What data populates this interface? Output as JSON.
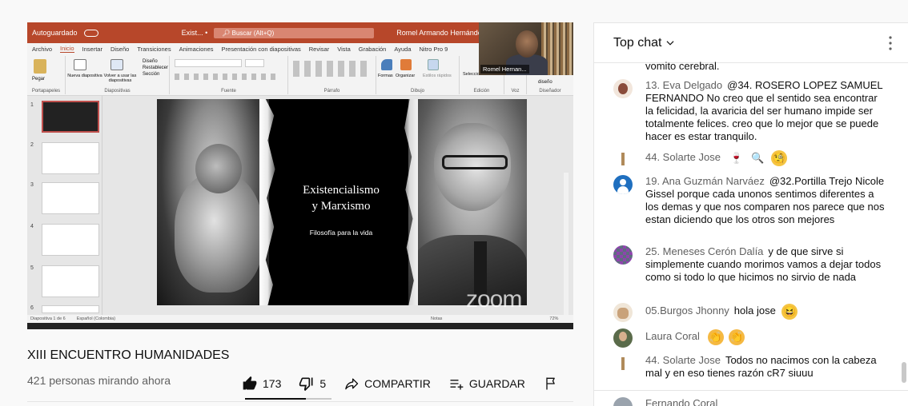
{
  "ppt": {
    "titlebar": {
      "autosave": "Autoguardado",
      "file": "Exist... •",
      "search": "Buscar (Alt+Q)",
      "user": "Romel Armando Hernández Sil..."
    },
    "tabs": [
      "Archivo",
      "Inicio",
      "Insertar",
      "Diseño",
      "Transiciones",
      "Animaciones",
      "Presentación con diapositivas",
      "Revisar",
      "Vista",
      "Grabación",
      "Ayuda",
      "Nitro Pro 9"
    ],
    "active_tab": "Inicio",
    "ribbon_groups": [
      "Portapapeles",
      "Diapositivas",
      "Fuente",
      "Párrafo",
      "Dibujo",
      "Edición",
      "Voz",
      "Diseñador"
    ],
    "ribbon_labels": {
      "paste": "Pegar",
      "new_slide": "Nueva diapositiva",
      "reuse": "Volver a usar las diapositivas",
      "layout": "Diseño",
      "reset": "Restablecer",
      "section": "Sección",
      "shapes": "Formas",
      "arrange": "Organizar",
      "styles": "Estilos rápidos",
      "select": "Seleccionar",
      "ideas": "diseño"
    },
    "slide_numbers": [
      "1",
      "2",
      "3",
      "4",
      "5",
      "6"
    ],
    "slide": {
      "title_line1": "Existencialismo",
      "title_line2": "y Marxismo",
      "subtitle": "Filosofía para la vida"
    },
    "webcam_name": "Romel Hernan...",
    "status_left": "Diapositiva 1 de 6",
    "status_lang": "Español (Colombia)",
    "status_notes": "Notas",
    "zoom_pct": "72%",
    "watermark": "zoom"
  },
  "video": {
    "title": "XIII ENCUENTRO HUMANIDADES",
    "viewers": "421 personas mirando ahora",
    "likes": "173",
    "dislikes": "5",
    "share_label": "COMPARTIR",
    "save_label": "GUARDAR",
    "like_ratio": 0.7
  },
  "chat": {
    "header": "Top chat",
    "messages": [
      {
        "author": "",
        "text": "vomito cerebral."
      },
      {
        "author": "13. Eva Delgado",
        "text": "@34. ROSERO LOPEZ SAMUEL FERNANDO No creo que el sentido sea encontrar la felicidad, la avaricia del ser humano impide ser totalmente felices. creo que lo mejor que se puede hacer es estar tranquilo."
      },
      {
        "author": "44. Solarte Jose",
        "text": "",
        "emojis": [
          "wine-glass-emoji",
          "magnifier-emoji",
          "monocle-face-emoji"
        ]
      },
      {
        "author": "19. Ana Guzmán Narváez",
        "text": "@32.Portilla Trejo Nicole Gissel porque cada unonos sentimos diferentes a los demas y que nos comparen nos parece que nos estan diciendo que los otros son mejores"
      },
      {
        "author": "25. Meneses Cerón Dalía",
        "text": "y de que sirve si simplemente cuando morimos vamos a dejar todos como si todo lo que hicimos no sirvio de nada"
      },
      {
        "author": "05.Burgos Jhonny",
        "text": "hola jose",
        "emojis": [
          "laughing-face-emoji"
        ]
      },
      {
        "author": "Laura Coral",
        "text": "",
        "emojis": [
          "clapping-hands-emoji",
          "clapping-hands-emoji"
        ]
      },
      {
        "author": "44. Solarte Jose",
        "text": "Todos no nacimos con la cabeza mal y en eso tienes razón cR7 siuuu"
      },
      {
        "author": "Fernando Coral",
        "text": ""
      }
    ]
  },
  "colors": {
    "ppt_accent": "#b7472a",
    "author_gray": "#606060",
    "chat_bg": "#ffffff",
    "page_bg": "#f9f9f9"
  }
}
